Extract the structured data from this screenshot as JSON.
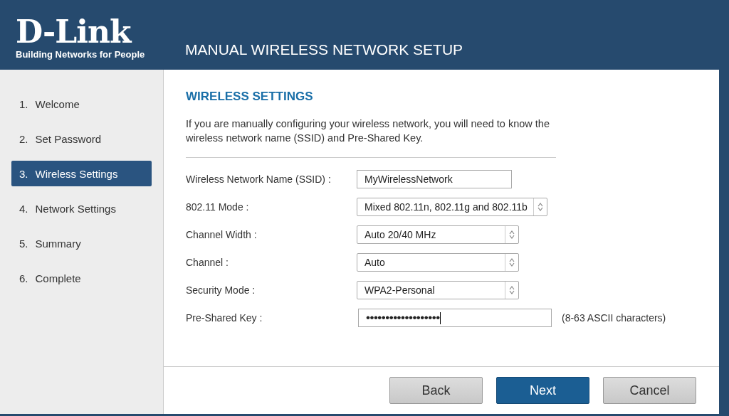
{
  "header": {
    "logo": "D-Link",
    "tagline": "Building Networks for People",
    "title": "MANUAL WIRELESS NETWORK SETUP"
  },
  "steps": [
    {
      "number": "1.",
      "label": "Welcome",
      "selected": false
    },
    {
      "number": "2.",
      "label": "Set Password",
      "selected": false
    },
    {
      "number": "3.",
      "label": "Wireless Settings",
      "selected": true
    },
    {
      "number": "4.",
      "label": "Network Settings",
      "selected": false
    },
    {
      "number": "5.",
      "label": "Summary",
      "selected": false
    },
    {
      "number": "6.",
      "label": "Complete",
      "selected": false
    }
  ],
  "section": {
    "heading": "WIRELESS SETTINGS",
    "intro": "If you are manually configuring your wireless network, you will need to know the wireless network name (SSID) and Pre-Shared Key."
  },
  "fields": [
    {
      "kind": "text",
      "label": "Wireless Network Name (SSID) :",
      "value": "MyWirelessNetwork"
    },
    {
      "kind": "select",
      "label": "802.11 Mode :",
      "value": "Mixed 802.11n, 802.11g and 802.11b"
    },
    {
      "kind": "select",
      "label": "Channel Width :",
      "value": "Auto 20/40 MHz"
    },
    {
      "kind": "select",
      "label": "Channel :",
      "value": "Auto"
    },
    {
      "kind": "select",
      "label": "Security Mode :",
      "value": "WPA2-Personal"
    },
    {
      "kind": "password",
      "label": "Pre-Shared Key :",
      "value": "•••••••••••••••••••",
      "hint": "(8-63 ASCII characters)"
    }
  ],
  "buttons": [
    {
      "label": "Back",
      "primary": false
    },
    {
      "label": "Next",
      "primary": true
    },
    {
      "label": "Cancel",
      "primary": false
    }
  ]
}
